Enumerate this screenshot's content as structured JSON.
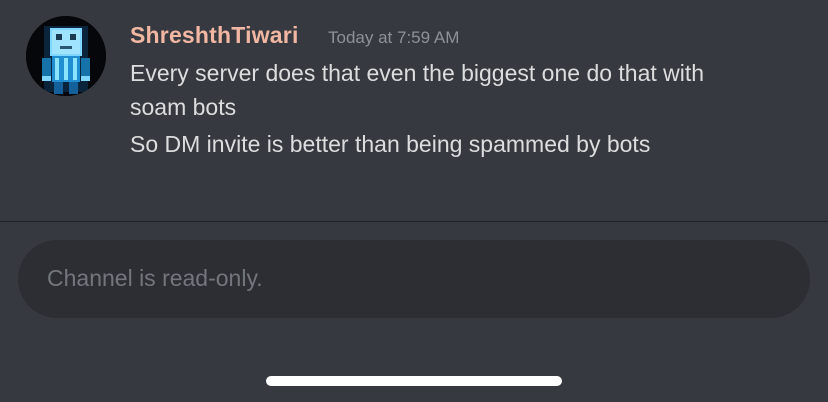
{
  "message": {
    "author": "ShreshthTiwari",
    "author_color": "#f2b7a2",
    "timestamp": "Today at 7:59 AM",
    "lines": [
      "Every server does that even the biggest one do that with",
      "soam bots",
      "So DM invite is better than being spammed by bots"
    ],
    "avatar_icon": "blue-blocky-character-avatar"
  },
  "composer": {
    "placeholder": "Channel is read-only."
  },
  "theme": {
    "background": "#36393f",
    "text": "#dcddde",
    "muted": "#8e9297",
    "composer_background": "#2c2e33"
  }
}
